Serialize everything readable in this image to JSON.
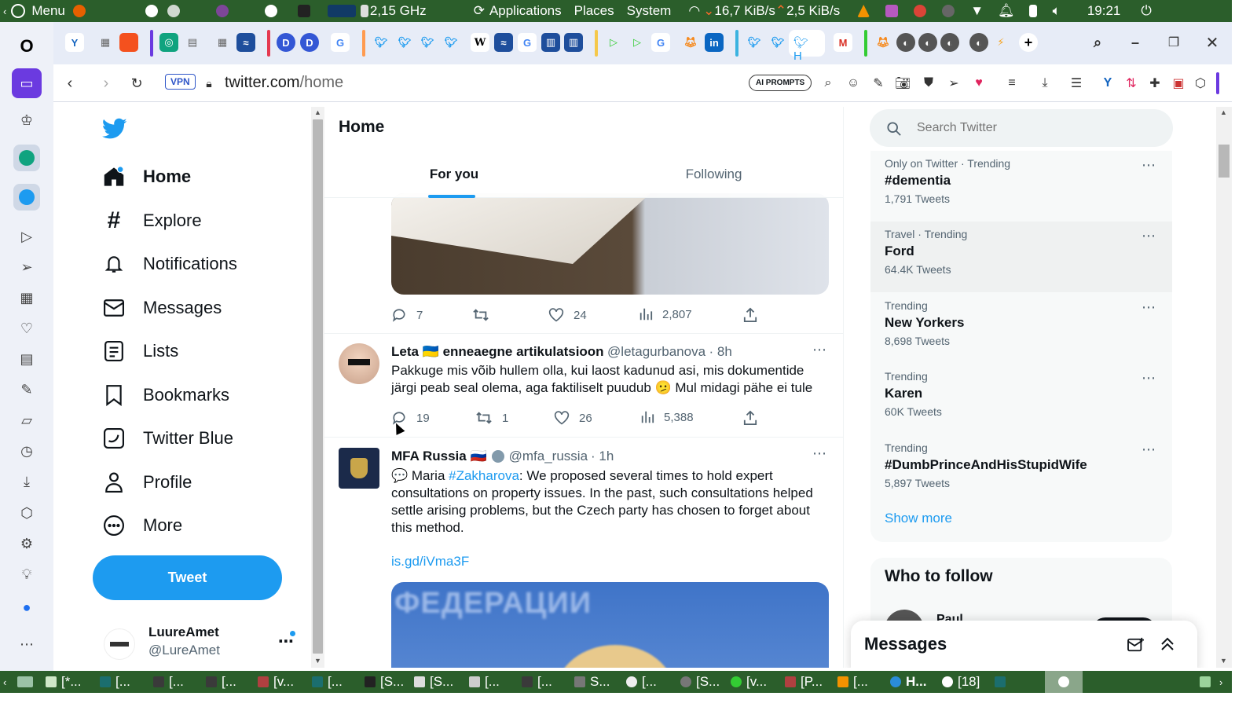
{
  "system_bar": {
    "menu_label": "Menu",
    "cpu_freq": "2,15 GHz",
    "applications": "Applications",
    "places": "Places",
    "system": "System",
    "net_down": "16,7 KiB/s",
    "net_up": "2,5 KiB/s",
    "clock": "19:21"
  },
  "address_bar": {
    "vpn_label": "VPN",
    "url_domain": "twitter.com",
    "url_path": "/home",
    "ai_prompts_label": "AI PROMPTS"
  },
  "nav": {
    "items": [
      {
        "label": "Home",
        "icon": "home-icon"
      },
      {
        "label": "Explore",
        "icon": "hashtag-icon"
      },
      {
        "label": "Notifications",
        "icon": "bell-icon"
      },
      {
        "label": "Messages",
        "icon": "envelope-icon"
      },
      {
        "label": "Lists",
        "icon": "list-icon"
      },
      {
        "label": "Bookmarks",
        "icon": "bookmark-icon"
      },
      {
        "label": "Twitter Blue",
        "icon": "twitter-blue-icon"
      },
      {
        "label": "Profile",
        "icon": "person-icon"
      },
      {
        "label": "More",
        "icon": "more-circle-icon"
      }
    ],
    "tweet_button": "Tweet",
    "account_name": "LuureAmet",
    "account_handle": "@LureAmet"
  },
  "timeline": {
    "title": "Home",
    "tabs": [
      "For you",
      "Following"
    ],
    "first_tweet_stats": {
      "replies": "7",
      "likes": "24",
      "views": "2,807"
    },
    "tweets": [
      {
        "name": "Leta 🇺🇦 enneaegne artikulatsioon",
        "handle": "@letagurbanova",
        "time": "· 8h",
        "text": "Pakkuge mis võib hullem olla, kui laost kadunud asi, mis dokumentide järgi peab seal olema, aga faktiliselt puudub 🫤 Mul midagi pähe ei tule",
        "replies": "19",
        "retweets": "1",
        "likes": "26",
        "views": "5,388"
      },
      {
        "name": "MFA Russia 🇷🇺",
        "handle": "@mfa_russia",
        "time": "· 1h",
        "text_prefix": "💬 Maria ",
        "hashtag": "#Zakharova",
        "text_rest": ": We proposed several times to hold expert consultations on property issues. In the past, such consultations helped settle arising problems, but the Czech party has chosen to forget about this method.",
        "link": "is.gd/iVma3F",
        "image_text": "ФЕДЕРАЦИИ"
      }
    ]
  },
  "sidebar": {
    "search_placeholder": "Search Twitter",
    "trends": [
      {
        "category": "Only on Twitter · Trending",
        "name": "#dementia",
        "count": "1,791 Tweets"
      },
      {
        "category": "Travel · Trending",
        "name": "Ford",
        "count": "64.4K Tweets"
      },
      {
        "category": "Trending",
        "name": "New Yorkers",
        "count": "8,698 Tweets"
      },
      {
        "category": "Trending",
        "name": "Karen",
        "count": "60K Tweets"
      },
      {
        "category": "Trending",
        "name": "#DumbPrinceAndHisStupidWife",
        "count": "5,897 Tweets"
      }
    ],
    "show_more": "Show more",
    "who_to_follow": "Who to follow",
    "follow_preview_name": "Paul",
    "messages_drawer": "Messages"
  },
  "taskbar": {
    "items": [
      "[*...",
      "[...",
      "[...",
      "[...",
      "[v...",
      "[...",
      "[S...",
      "[S...",
      "[...",
      "[...",
      "S...",
      "[...",
      "[S...",
      "[v...",
      "[P...",
      "[...",
      "H...",
      "[18]"
    ]
  },
  "colors": {
    "accent": "#1d9bf0",
    "system_bar": "#2b5e2b",
    "text_primary": "#0f1419",
    "text_secondary": "#536471"
  }
}
